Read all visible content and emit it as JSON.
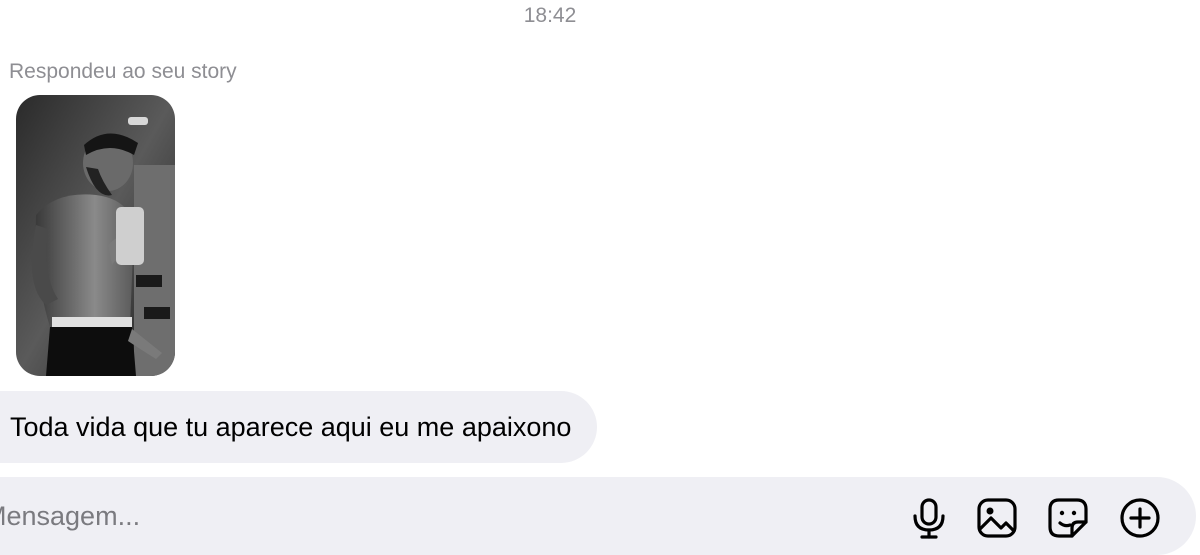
{
  "chat": {
    "timestamp": "18:42",
    "reply_caption": "Respondeu ao seu story",
    "story_thumbnail": {
      "description_icon": "story-photo",
      "tone": "grayscale"
    },
    "message": {
      "text": "Toda vida que tu aparece aqui eu me apaixono"
    }
  },
  "composer": {
    "placeholder": "Mensagem...",
    "value": "",
    "icons": [
      "microphone-icon",
      "image-gallery-icon",
      "sticker-icon",
      "add-icon"
    ]
  },
  "colors": {
    "bubble_bg": "#efeff4",
    "muted_text": "#8e8e93",
    "icon": "#000000"
  }
}
